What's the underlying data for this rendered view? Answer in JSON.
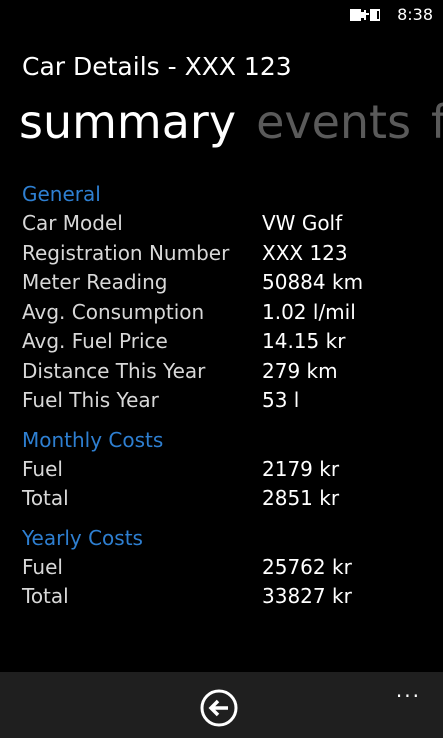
{
  "status_bar": {
    "time": "8:38",
    "battery_icon": "battery-charging-icon"
  },
  "header": {
    "title": "Car Details - XXX 123"
  },
  "pivot": {
    "items": [
      "summary",
      "events",
      "fu"
    ]
  },
  "sections": {
    "general": {
      "title": "General",
      "rows": [
        {
          "label": "Car Model",
          "value": "VW Golf"
        },
        {
          "label": "Registration Number",
          "value": "XXX 123"
        },
        {
          "label": "Meter Reading",
          "value": "50884  km"
        },
        {
          "label": "Avg. Consumption",
          "value": "1.02  l/mil"
        },
        {
          "label": "Avg. Fuel Price",
          "value": "14.15  kr"
        },
        {
          "label": "Distance This Year",
          "value": "279  km"
        },
        {
          "label": "Fuel This Year",
          "value": "53  l"
        }
      ]
    },
    "monthly": {
      "title": "Monthly Costs",
      "rows": [
        {
          "label": "Fuel",
          "value": "2179  kr"
        },
        {
          "label": "Total",
          "value": "2851  kr"
        }
      ]
    },
    "yearly": {
      "title": "Yearly Costs",
      "rows": [
        {
          "label": "Fuel",
          "value": "25762  kr"
        },
        {
          "label": "Total",
          "value": "33827  kr"
        }
      ]
    }
  },
  "app_bar": {
    "back_icon": "back-arrow-icon",
    "more_label": "..."
  },
  "colors": {
    "accent": "#2e7fd1",
    "background": "#000000",
    "app_bar": "#1f1f1f",
    "inactive_pivot": "#5a5a5a"
  }
}
